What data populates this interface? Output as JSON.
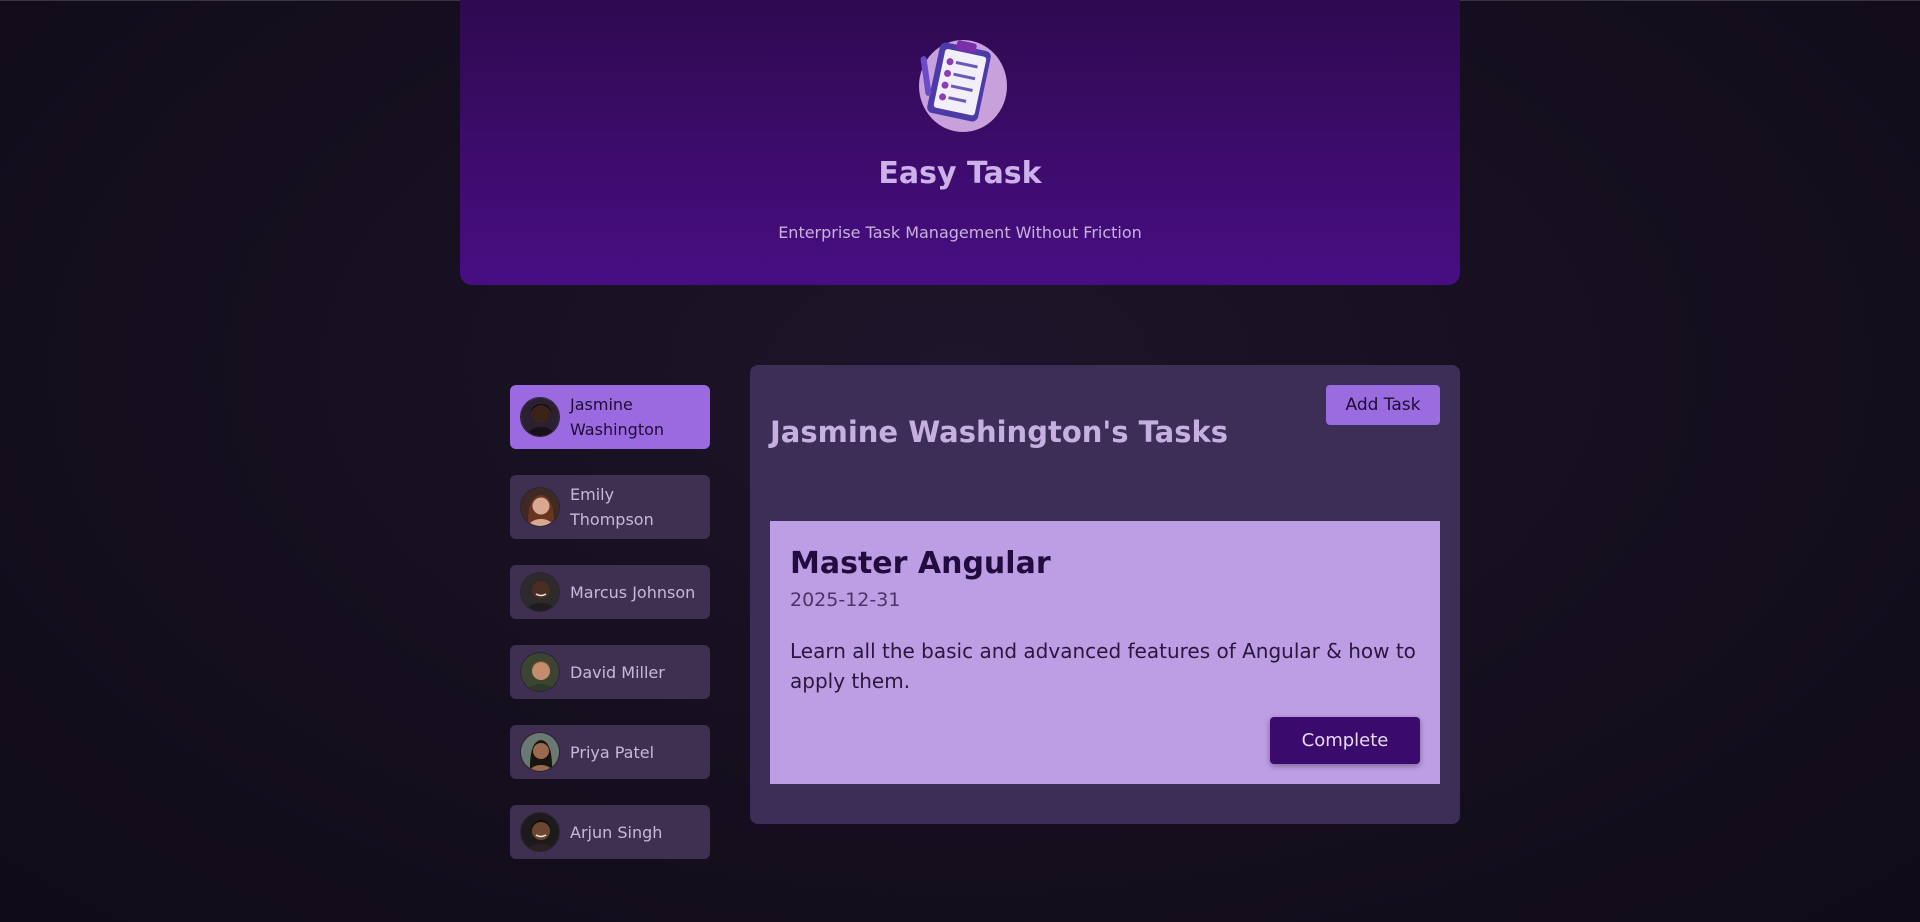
{
  "app": {
    "title": "Easy Task",
    "subtitle": "Enterprise Task Management Without Friction",
    "logo_icon": "clipboard-checklist-icon"
  },
  "users": [
    {
      "name": "Jasmine Washington",
      "active": true,
      "skin": "#3a2418"
    },
    {
      "name": "Emily Thompson",
      "active": false,
      "skin": "#c99a82"
    },
    {
      "name": "Marcus Johnson",
      "active": false,
      "skin": "#4a2e22"
    },
    {
      "name": "David Miller",
      "active": false,
      "skin": "#c48e6e"
    },
    {
      "name": "Priya Patel",
      "active": false,
      "skin": "#9a6a4c"
    },
    {
      "name": "Arjun Singh",
      "active": false,
      "skin": "#6d4630"
    }
  ],
  "tasks_panel": {
    "title": "Jasmine Washington's Tasks",
    "add_button_label": "Add Task",
    "tasks": [
      {
        "title": "Master Angular",
        "due_date": "2025-12-31",
        "description": "Learn all the basic and advanced features of Angular & how to apply them.",
        "complete_label": "Complete"
      }
    ]
  },
  "colors": {
    "header_top": "#2e0a50",
    "header_bottom": "#470e83",
    "active_user": "#9c6ae0",
    "user_bg": "#3f3052",
    "panel_bg": "#3d2e58",
    "task_bg": "#bd9de3",
    "complete_button": "#3a0b6c"
  }
}
